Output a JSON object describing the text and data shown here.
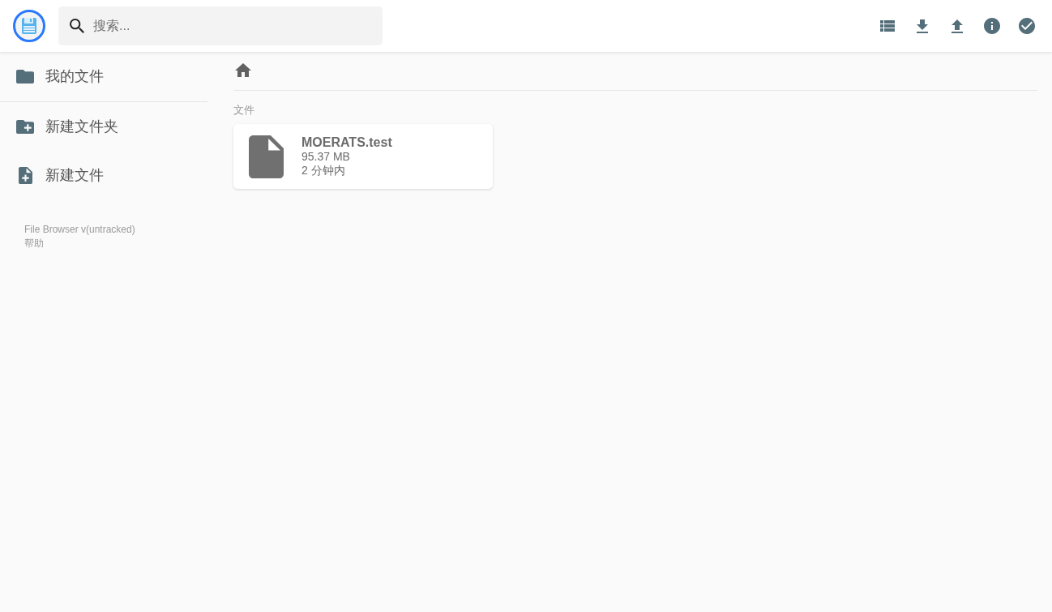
{
  "header": {
    "search": {
      "placeholder": "搜索..."
    }
  },
  "sidebar": {
    "nav_items": [
      {
        "kind": "folder",
        "label": "我的文件"
      }
    ],
    "action_items": [
      {
        "kind": "new-folder",
        "label": "新建文件夹"
      },
      {
        "kind": "new-file",
        "label": "新建文件"
      }
    ],
    "footer": {
      "version": "File Browser v(untracked)",
      "help_link": "帮助"
    }
  },
  "main": {
    "section_title": "文件",
    "files": [
      {
        "name": "MOERATS.test",
        "size": "95.37 MB",
        "modified": "2 分钟内"
      }
    ]
  }
}
